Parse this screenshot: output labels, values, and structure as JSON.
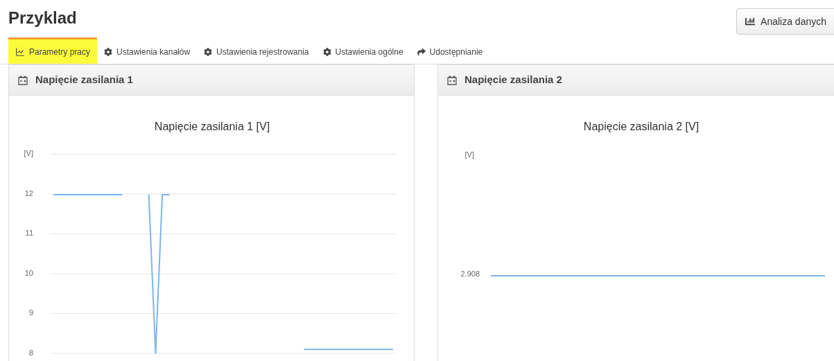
{
  "page": {
    "title": "Przyklad"
  },
  "header_button": {
    "label": "Analiza danych"
  },
  "tabs": [
    {
      "label": "Parametry pracy",
      "kind": "chart",
      "selected": true
    },
    {
      "label": "Ustawienia kanałów",
      "kind": "gear",
      "selected": false
    },
    {
      "label": "Ustawienia rejestrowania",
      "kind": "gear",
      "selected": false
    },
    {
      "label": "Ustawienia ogólne",
      "kind": "gear",
      "selected": false
    },
    {
      "label": "Udostępnianie",
      "kind": "share",
      "selected": false
    }
  ],
  "panels": [
    {
      "title": "Napięcie zasilania 1",
      "chart_data": {
        "type": "line",
        "title": "Napięcie zasilania 1 [V]",
        "ylabel": "[V]",
        "grid": true,
        "ylim": [
          8,
          13
        ],
        "yticks": [
          8,
          9,
          10,
          11,
          12
        ],
        "categories": [
          null,
          null,
          null,
          null,
          null,
          null,
          null,
          null,
          null,
          null,
          null,
          null,
          null,
          null,
          null,
          null,
          null,
          null,
          null,
          null,
          null,
          null,
          null,
          null,
          null,
          null,
          null,
          null,
          null,
          null,
          null,
          null,
          null,
          null,
          null,
          null,
          null,
          null,
          null,
          null,
          null,
          null,
          null,
          null,
          null,
          null,
          null,
          null,
          null,
          null,
          null
        ],
        "series": [
          {
            "color": "#7cb5ec",
            "values": [
              11.98,
              11.98,
              11.98,
              11.98,
              11.98,
              11.98,
              11.98,
              11.98,
              11.98,
              11.98,
              11.98,
              null,
              null,
              null,
              11.98,
              8.0,
              11.98,
              11.98,
              null,
              null,
              null,
              null,
              null,
              null,
              null,
              null,
              null,
              null,
              null,
              null,
              null,
              null,
              null,
              null,
              null,
              null,
              null,
              8.1,
              8.1,
              8.1,
              8.1,
              8.1,
              8.1,
              8.1,
              8.1,
              8.1,
              8.1,
              8.1,
              8.1,
              8.1,
              8.1
            ]
          }
        ]
      }
    },
    {
      "title": "Napięcie zasilania 2",
      "chart": {
        "title": "Napięcie zasilania 2 [V]",
        "ylabel": "[V]",
        "tick_label": "2.908"
      }
    }
  ]
}
